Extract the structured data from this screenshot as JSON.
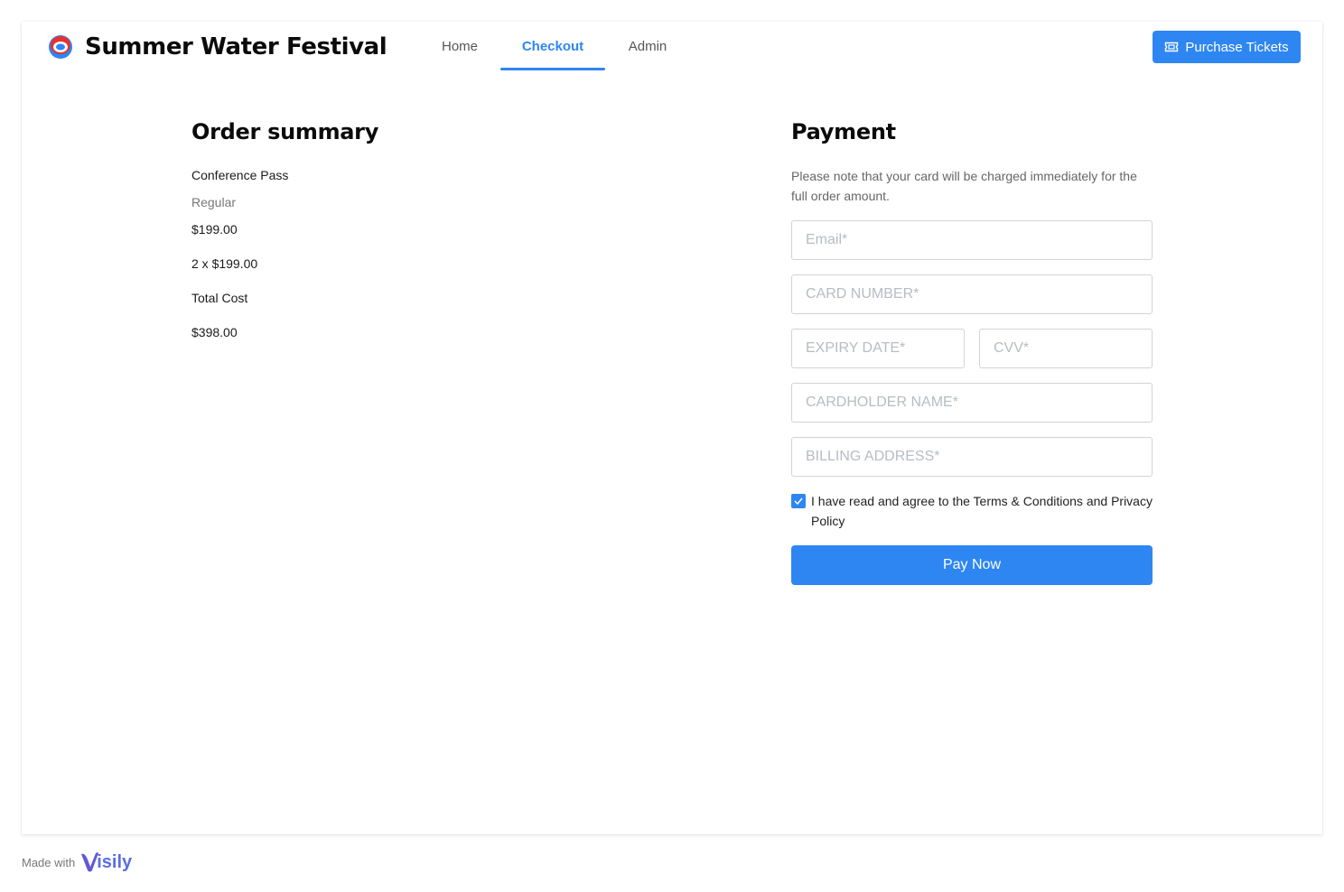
{
  "app": {
    "title": "Summer Water Festival",
    "logo_icon": "festival-logo-icon"
  },
  "nav": {
    "items": [
      {
        "label": "Home",
        "active": false
      },
      {
        "label": "Checkout",
        "active": true
      },
      {
        "label": "Admin",
        "active": false
      }
    ]
  },
  "header": {
    "purchase_label": "Purchase Tickets",
    "purchase_icon": "ticket-icon"
  },
  "order": {
    "title": "Order summary",
    "item_name": "Conference Pass",
    "item_type": "Regular",
    "item_price": "$199.00",
    "quantity_line": "2 x $199.00",
    "total_label": "Total Cost",
    "total_value": "$398.00"
  },
  "payment": {
    "title": "Payment",
    "note": "Please note that your card will be charged immediately for the full order amount.",
    "fields": {
      "email": "Email*",
      "card_number": "CARD NUMBER*",
      "expiry": "EXPIRY DATE*",
      "cvv": "CVV*",
      "cardholder": "CARDHOLDER NAME*",
      "billing": "BILLING ADDRESS*"
    },
    "agree_text": "I have read and agree to the Terms & Conditions and Privacy Policy",
    "agree_checked": true,
    "pay_label": "Pay Now"
  },
  "footer": {
    "made_with": "Made with",
    "brand": "isily"
  },
  "colors": {
    "accent": "#2e86f2",
    "text": "#0b0b0b",
    "muted": "#777777",
    "border": "#cfd3d8"
  }
}
